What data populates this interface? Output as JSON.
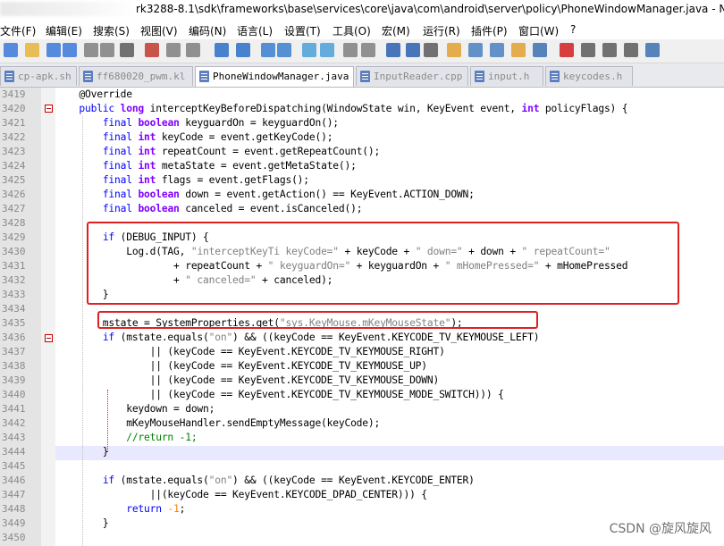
{
  "window": {
    "title_path": "rk3288-8.1\\sdk\\frameworks\\base\\services\\core\\java\\com\\android\\server\\policy\\PhoneWindowManager.java - N"
  },
  "menu": [
    "文件(F)",
    "编辑(E)",
    "搜索(S)",
    "视图(V)",
    "编码(N)",
    "语言(L)",
    "设置(T)",
    "工具(O)",
    "宏(M)",
    "运行(R)",
    "插件(P)",
    "窗口(W)",
    "?"
  ],
  "tabs": [
    {
      "label": "cp-apk.sh"
    },
    {
      "label": "ff680020_pwm.kl"
    },
    {
      "label": "PhoneWindowManager.java",
      "active": true
    },
    {
      "label": "InputReader.cpp"
    },
    {
      "label": "input.h"
    },
    {
      "label": "keycodes.h"
    }
  ],
  "lines": [
    {
      "n": "3419",
      "t": "    @Override"
    },
    {
      "n": "3420",
      "t": "    public long interceptKeyBeforeDispatching(WindowState win, KeyEvent event, int policyFlags) {"
    },
    {
      "n": "3421",
      "t": "        final boolean keyguardOn = keyguardOn();"
    },
    {
      "n": "3422",
      "t": "        final int keyCode = event.getKeyCode();"
    },
    {
      "n": "3423",
      "t": "        final int repeatCount = event.getRepeatCount();"
    },
    {
      "n": "3424",
      "t": "        final int metaState = event.getMetaState();"
    },
    {
      "n": "3425",
      "t": "        final int flags = event.getFlags();"
    },
    {
      "n": "3426",
      "t": "        final boolean down = event.getAction() == KeyEvent.ACTION_DOWN;"
    },
    {
      "n": "3427",
      "t": "        final boolean canceled = event.isCanceled();"
    },
    {
      "n": "3428",
      "t": ""
    },
    {
      "n": "3429",
      "t": "        if (DEBUG_INPUT) {"
    },
    {
      "n": "3430",
      "t": "            Log.d(TAG, \"interceptKeyTi keyCode=\" + keyCode + \" down=\" + down + \" repeatCount=\""
    },
    {
      "n": "3431",
      "t": "                    + repeatCount + \" keyguardOn=\" + keyguardOn + \" mHomePressed=\" + mHomePressed"
    },
    {
      "n": "3432",
      "t": "                    + \" canceled=\" + canceled);"
    },
    {
      "n": "3433",
      "t": "        }"
    },
    {
      "n": "3434",
      "t": ""
    },
    {
      "n": "3435",
      "t": "        mstate = SystemProperties.get(\"sys.KeyMouse.mKeyMouseState\");"
    },
    {
      "n": "3436",
      "t": "        if (mstate.equals(\"on\") && ((keyCode == KeyEvent.KEYCODE_TV_KEYMOUSE_LEFT)"
    },
    {
      "n": "3437",
      "t": "                || (keyCode == KeyEvent.KEYCODE_TV_KEYMOUSE_RIGHT)"
    },
    {
      "n": "3438",
      "t": "                || (keyCode == KeyEvent.KEYCODE_TV_KEYMOUSE_UP)"
    },
    {
      "n": "3439",
      "t": "                || (keyCode == KeyEvent.KEYCODE_TV_KEYMOUSE_DOWN)"
    },
    {
      "n": "3440",
      "t": "                || (keyCode == KeyEvent.KEYCODE_TV_KEYMOUSE_MODE_SWITCH))) {"
    },
    {
      "n": "3441",
      "t": "            keydown = down;"
    },
    {
      "n": "3442",
      "t": "            mKeyMouseHandler.sendEmptyMessage(keyCode);"
    },
    {
      "n": "3443",
      "t": "            //return -1;"
    },
    {
      "n": "3444",
      "t": "        }"
    },
    {
      "n": "3445",
      "t": ""
    },
    {
      "n": "3446",
      "t": "        if (mstate.equals(\"on\") && ((keyCode == KeyEvent.KEYCODE_ENTER)"
    },
    {
      "n": "3447",
      "t": "                ||(keyCode == KeyEvent.KEYCODE_DPAD_CENTER))) {"
    },
    {
      "n": "3448",
      "t": "            return -1;"
    },
    {
      "n": "3449",
      "t": "        }"
    },
    {
      "n": "3450",
      "t": ""
    }
  ],
  "watermark": "CSDN @旋风旋风",
  "colors": {
    "keyword": "#0000ff",
    "type": "#8000ff",
    "string": "#808080",
    "number": "#ff8000",
    "comment": "#008000",
    "highlight_box": "#e02020",
    "current_line": "#e8e8ff"
  },
  "toolbar_icons": [
    "new-file-icon",
    "open-file-icon",
    "save-icon",
    "save-all-icon",
    "close-icon",
    "close-all-icon",
    "print-icon",
    "cut-icon",
    "copy-icon",
    "paste-icon",
    "undo-icon",
    "redo-icon",
    "find-icon",
    "replace-icon",
    "zoom-in-icon",
    "zoom-out-icon",
    "sync-v-icon",
    "sync-h-icon",
    "word-wrap-icon",
    "show-all-chars-icon",
    "indent-guide-icon",
    "user-lang-icon",
    "doc-map-icon",
    "function-list-icon",
    "folder-workspace-icon",
    "monitor-icon",
    "record-macro-icon",
    "stop-macro-icon",
    "play-macro-icon",
    "run-macro-multiple-icon",
    "save-macro-icon"
  ]
}
